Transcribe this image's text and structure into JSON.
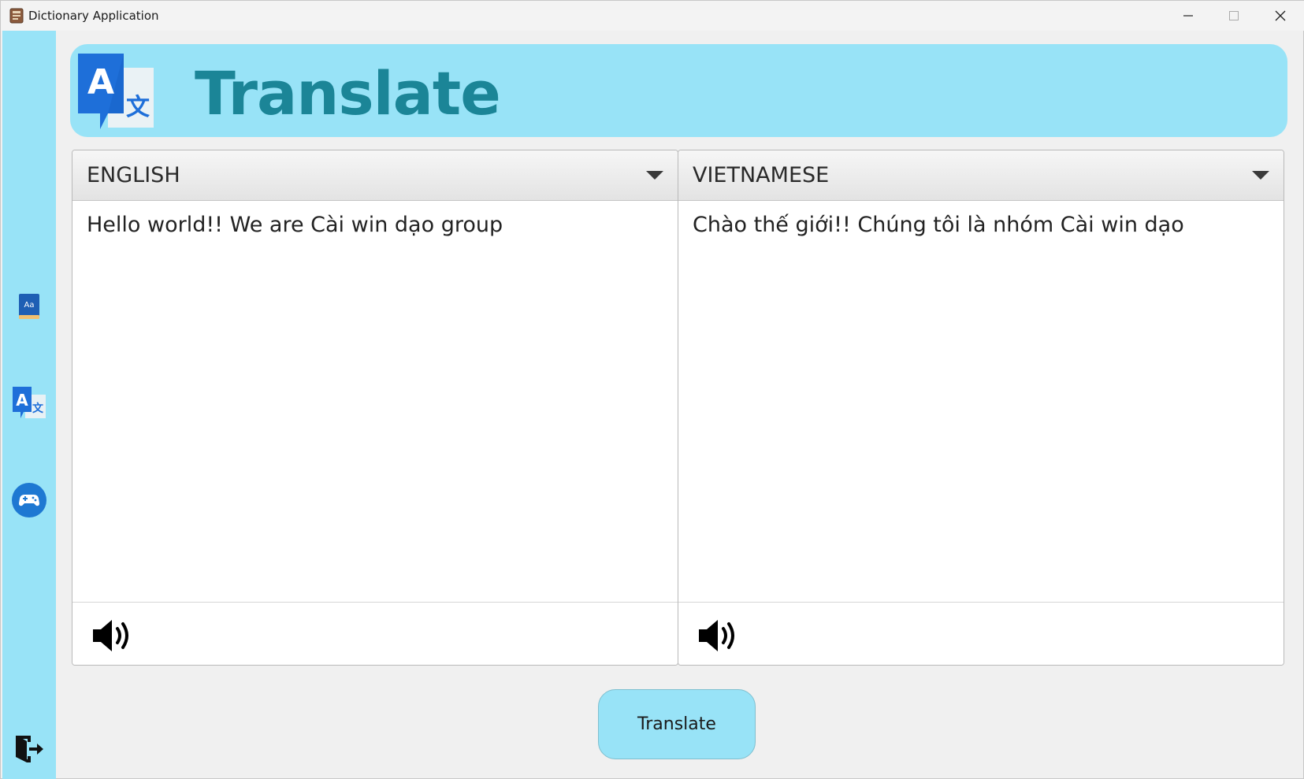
{
  "window": {
    "title": "Dictionary Application",
    "controls": [
      "minimize",
      "maximize",
      "close"
    ]
  },
  "sidebar": {
    "items": [
      {
        "name": "dictionary",
        "icon": "dictionary-book-icon"
      },
      {
        "name": "translate",
        "icon": "translate-icon"
      },
      {
        "name": "game",
        "icon": "gamepad-icon"
      },
      {
        "name": "exit",
        "icon": "exit-icon"
      }
    ]
  },
  "header": {
    "title": "Translate",
    "logo_icon": "translate-icon"
  },
  "source": {
    "language": "ENGLISH",
    "text": "Hello world!! We are Cài win dạo group",
    "speaker_icon": "speaker-icon"
  },
  "target": {
    "language": "VIETNAMESE",
    "text": "Chào thế giới!! Chúng tôi là nhóm Cài win dạo",
    "speaker_icon": "speaker-icon"
  },
  "actions": {
    "translate_label": "Translate"
  },
  "colors": {
    "accent": "#98e3f7",
    "title_text": "#1b8597",
    "icon_blue": "#1e6fd9"
  }
}
